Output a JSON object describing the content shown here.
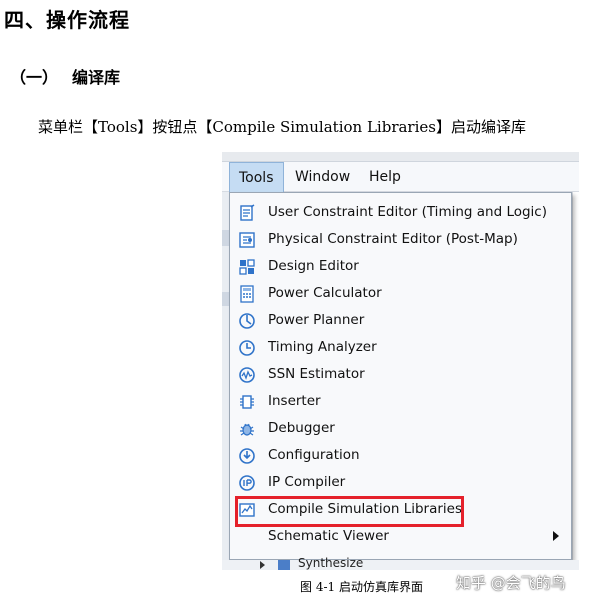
{
  "heading": "四、操作流程",
  "subheading": {
    "num": "（一）",
    "text": "编译库"
  },
  "paragraph": "菜单栏【Tools】按钮点【Compile Simulation Libraries】启动编译库",
  "menubar": [
    "Tools",
    "Window",
    "Help"
  ],
  "menu_items": [
    {
      "label": "User Constraint Editor (Timing and Logic)",
      "icon": "constraint-editor-icon"
    },
    {
      "label": "Physical Constraint Editor (Post-Map)",
      "icon": "physical-constraint-icon"
    },
    {
      "label": "Design Editor",
      "icon": "design-editor-icon"
    },
    {
      "label": "Power Calculator",
      "icon": "power-calculator-icon"
    },
    {
      "label": "Power Planner",
      "icon": "power-planner-icon"
    },
    {
      "label": "Timing Analyzer",
      "icon": "timing-analyzer-icon"
    },
    {
      "label": "SSN Estimator",
      "icon": "ssn-estimator-icon"
    },
    {
      "label": "Inserter",
      "icon": "inserter-icon"
    },
    {
      "label": "Debugger",
      "icon": "debugger-icon"
    },
    {
      "label": "Configuration",
      "icon": "configuration-icon"
    },
    {
      "label": "IP Compiler",
      "icon": "ip-compiler-icon"
    },
    {
      "label": "Compile Simulation Libraries",
      "icon": "compile-sim-libraries-icon"
    },
    {
      "label": "Schematic Viewer",
      "icon": ""
    }
  ],
  "highlighted_item": "Compile Simulation Libraries",
  "tree_item": "Synthesize",
  "caption": "图 4-1 启动仿真库界面",
  "watermark": "知乎 @会飞的鸟",
  "colors": {
    "highlight": "#e5212b",
    "active_menu": "#c5dcf3",
    "icon_blue": "#2f73c9"
  }
}
